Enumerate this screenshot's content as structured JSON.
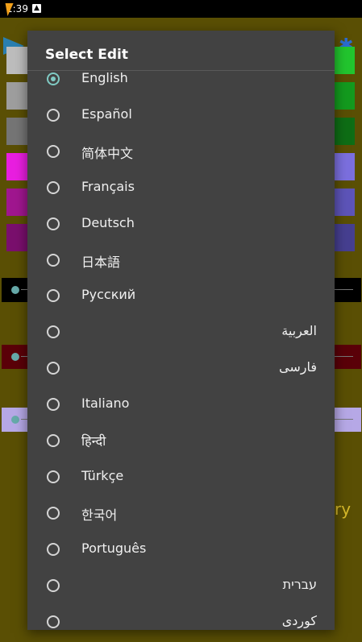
{
  "status_bar": {
    "time": "1:39",
    "notification_icon": "android-notification-icon"
  },
  "background": {
    "partial_text": "ry"
  },
  "dialog": {
    "title": "Select Edit",
    "options": [
      {
        "label": "English",
        "selected": true,
        "rtl": false
      },
      {
        "label": "Español",
        "selected": false,
        "rtl": false
      },
      {
        "label": "简体中文",
        "selected": false,
        "rtl": false
      },
      {
        "label": "Français",
        "selected": false,
        "rtl": false
      },
      {
        "label": "Deutsch",
        "selected": false,
        "rtl": false
      },
      {
        "label": "日本語",
        "selected": false,
        "rtl": false
      },
      {
        "label": "Русский",
        "selected": false,
        "rtl": false
      },
      {
        "label": "العربية",
        "selected": false,
        "rtl": true
      },
      {
        "label": "فارسی",
        "selected": false,
        "rtl": true
      },
      {
        "label": "Italiano",
        "selected": false,
        "rtl": false
      },
      {
        "label": "हिन्दी",
        "selected": false,
        "rtl": false
      },
      {
        "label": "Türkçe",
        "selected": false,
        "rtl": false
      },
      {
        "label": "한국어",
        "selected": false,
        "rtl": false
      },
      {
        "label": "Português",
        "selected": false,
        "rtl": false
      },
      {
        "label": "עברית",
        "selected": false,
        "rtl": true
      },
      {
        "label": "کوردی",
        "selected": false,
        "rtl": true
      }
    ]
  },
  "colors": {
    "accent": "#80cbc4",
    "dialog_bg": "#424242"
  }
}
